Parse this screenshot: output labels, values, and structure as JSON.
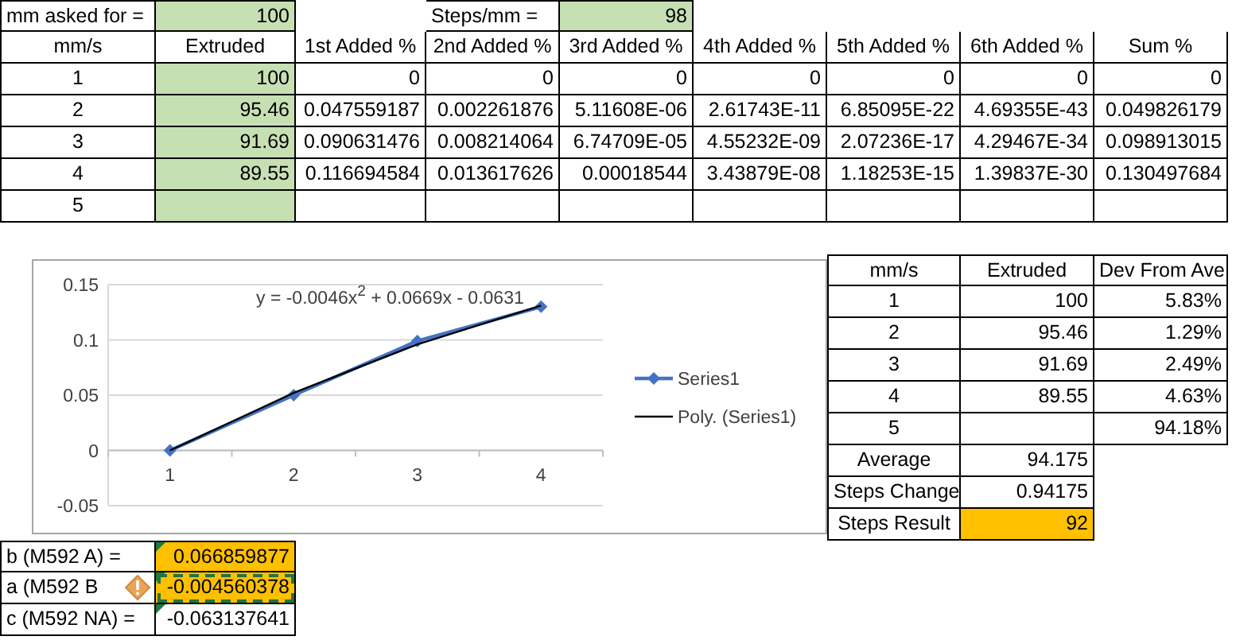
{
  "inputs": [
    {
      "label": "mm asked for =",
      "value": "100"
    },
    {
      "label": "Steps/mm =",
      "value": "98"
    }
  ],
  "main_table": {
    "columns": [
      "mm/s",
      "Extruded",
      "1st Added %",
      "2nd Added %",
      "3rd Added %",
      "4th Added %",
      "5th Added %",
      "6th Added %",
      "Sum %"
    ],
    "rows": [
      [
        "1",
        "100",
        "0",
        "0",
        "0",
        "0",
        "0",
        "0",
        "0"
      ],
      [
        "2",
        "95.46",
        "0.047559187",
        "0.002261876",
        "5.11608E-06",
        "2.61743E-11",
        "6.85095E-22",
        "4.69355E-43",
        "0.049826179"
      ],
      [
        "3",
        "91.69",
        "0.090631476",
        "0.008214064",
        "6.74709E-05",
        "4.55232E-09",
        "2.07236E-17",
        "4.29467E-34",
        "0.098913015"
      ],
      [
        "4",
        "89.55",
        "0.116694584",
        "0.013617626",
        "0.00018544",
        "3.43879E-08",
        "1.18253E-15",
        "1.39837E-30",
        "0.130497684"
      ],
      [
        "5"
      ]
    ]
  },
  "chart": {
    "chart_data": {
      "type": "line",
      "categories": [
        "1",
        "2",
        "3",
        "4"
      ],
      "grid": true,
      "legend": true,
      "series": [
        {
          "name": "Series1",
          "color": "#4472c4",
          "marker": "diamond",
          "values": [
            0,
            0.05,
            0.099,
            0.13
          ]
        },
        {
          "name": "Poly. (Series1)",
          "color": "#000000",
          "values": [
            0,
            0.052,
            0.096,
            0.131
          ]
        }
      ],
      "ylim": [
        -0.05,
        0.15
      ],
      "yticks": [
        {
          "value": -0.05,
          "label": "-0.05"
        },
        {
          "value": 0,
          "label": "0"
        },
        {
          "value": 0.05,
          "label": "0.05"
        },
        {
          "value": 0.1,
          "label": "0.1"
        },
        {
          "value": 0.15,
          "label": "0.15"
        }
      ],
      "annotations": [
        "y = -0.0046x$^{2}$ + 0.0669x - 0.0631"
      ]
    }
  },
  "summary_table": {
    "columns": [
      "mm/s",
      "Extruded",
      "Dev From Ave"
    ],
    "rows": [
      {
        "speed": "1",
        "extruded": "100",
        "deviation": "5.83%"
      },
      {
        "speed": "2",
        "extruded": "95.46",
        "deviation": "1.29%"
      },
      {
        "speed": "3",
        "extruded": "91.69",
        "deviation": "2.49%"
      },
      {
        "speed": "4",
        "extruded": "89.55",
        "deviation": "4.63%"
      },
      {
        "speed": "5",
        "deviation": "94.18%"
      }
    ],
    "stats": [
      {
        "label": "Average",
        "value": "94.175",
        "highlighted": false
      },
      {
        "label": "Steps Change",
        "value": "0.94175",
        "highlighted": false
      },
      {
        "label": "Steps Result",
        "value": "92",
        "highlighted": true
      }
    ]
  },
  "coefficients": [
    {
      "label": "b (M592 A) =",
      "value": "0.066859877",
      "highlighted": true,
      "selected": false,
      "warning": false
    },
    {
      "label": "a (M592 B",
      "value": "-0.004560378",
      "highlighted": true,
      "selected": true,
      "warning": true
    },
    {
      "label": "c (M592 NA) =",
      "value": "-0.063137641",
      "highlighted": false,
      "selected": false,
      "warning": false
    }
  ]
}
